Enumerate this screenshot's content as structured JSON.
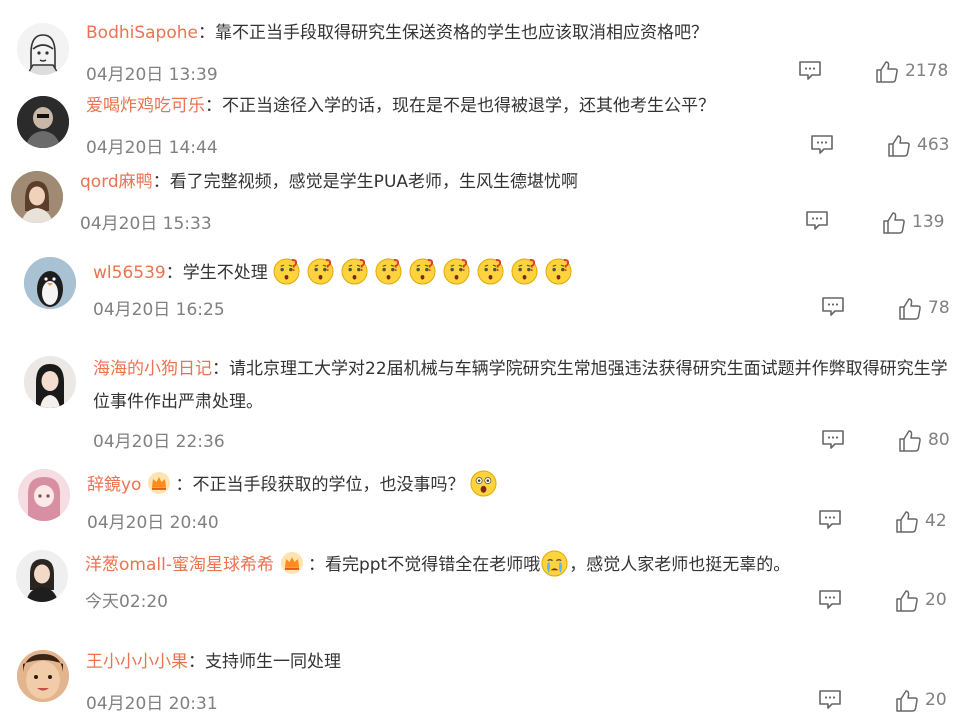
{
  "colors": {
    "username": "#eb7350",
    "text": "#333333",
    "meta": "#808080"
  },
  "separator": "：",
  "comments": [
    {
      "user": "BodhiSapohe",
      "text": "靠不正当手段取得研究生保送资格的学生也应该取消相应资格吧？",
      "time": "04月20日 13:39",
      "likes": "2178",
      "avatar_icon": "line-art-portrait-avatar"
    },
    {
      "user": "爱喝炸鸡吃可乐",
      "text": "不正当途径入学的话，现在是不是也得被退学，还其他考生公平？",
      "time": "04月20日 14:44",
      "likes": "463",
      "avatar_icon": "dark-photo-avatar"
    },
    {
      "user": "qord麻鸭",
      "text": "看了完整视频，感觉是学生PUA老师，生风生德堪忧啊",
      "time": "04月20日 15:33",
      "likes": "139",
      "avatar_icon": "girl-photo-avatar"
    },
    {
      "user": "wl56539",
      "text": "学生不处理",
      "emoji_icon": "thinking-emoji-icon",
      "emoji_count": 9,
      "time": "04月20日 16:25",
      "likes": "78",
      "avatar_icon": "penguin-avatar"
    },
    {
      "user": "海海的小狗日记",
      "text": "请北京理工大学对22届机械与车辆学院研究生常旭强违法获得研究生面试题并作弊取得研究生学位事件作出严肃处理。",
      "time": "04月20日 22:36",
      "likes": "80",
      "avatar_icon": "woman-portrait-avatar"
    },
    {
      "user": "辞鏡yo",
      "vip_icon": "vip-crown-icon",
      "text": "不正当手段获取的学位，也没事吗？",
      "emoji_icon": "shocked-emoji-icon",
      "time": "04月20日 20:40",
      "likes": "42",
      "avatar_icon": "anime-pink-avatar"
    },
    {
      "user": "洋葱omall-蜜淘星球希希",
      "vip_icon": "vip-crown-icon",
      "text_before": "看完ppt不觉得错全在老师哦",
      "emoji_icon": "crying-emoji-icon",
      "text_after": "，感觉人家老师也挺无辜的。",
      "time": "今天02:20",
      "likes": "20",
      "avatar_icon": "woman-photo-avatar"
    },
    {
      "user": "王小小小小果",
      "text": "支持师生一同处理",
      "time": "04月20日 20:31",
      "likes": "20",
      "avatar_icon": "child-face-avatar"
    }
  ]
}
